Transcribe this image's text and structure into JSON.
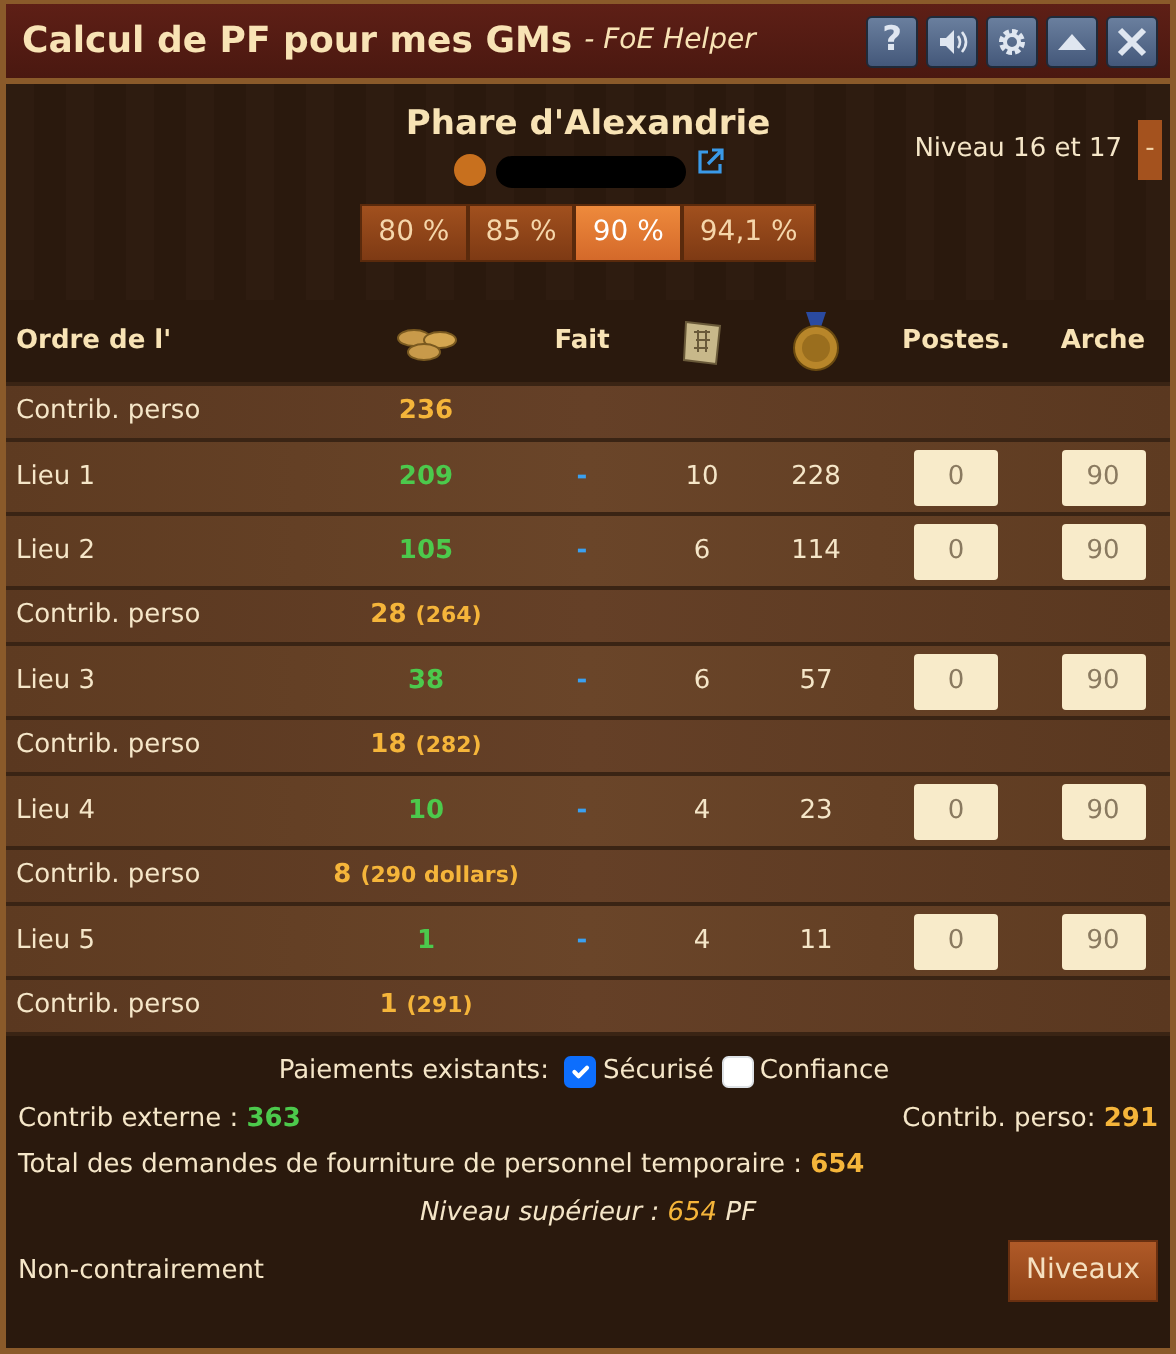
{
  "window": {
    "title": "Calcul de PF pour mes GMs",
    "subtitle": "- FoE Helper",
    "help": "?"
  },
  "building": {
    "name": "Phare d'Alexandrie",
    "level_label": "Niveau 16 et 17",
    "collapse": "-"
  },
  "percentages": [
    {
      "label": "80 %",
      "selected": false
    },
    {
      "label": "85 %",
      "selected": false
    },
    {
      "label": "90 %",
      "selected": true
    },
    {
      "label": "94,1 %",
      "selected": false
    }
  ],
  "columns": {
    "order": "Ordre de l'",
    "done": "Fait",
    "posts": "Postes.",
    "arch": "Arche"
  },
  "rows": [
    {
      "kind": "own",
      "label": "Contrib. perso",
      "amount": "236"
    },
    {
      "kind": "place",
      "label": "Lieu 1",
      "value": "209",
      "done": "-",
      "blueprints": "10",
      "medals": "228",
      "posts": "0",
      "arch": "90"
    },
    {
      "kind": "place",
      "label": "Lieu 2",
      "value": "105",
      "done": "-",
      "blueprints": "6",
      "medals": "114",
      "posts": "0",
      "arch": "90"
    },
    {
      "kind": "own",
      "label": "Contrib. perso",
      "amount": "28",
      "total": "(264)"
    },
    {
      "kind": "place",
      "label": "Lieu 3",
      "value": "38",
      "done": "-",
      "blueprints": "6",
      "medals": "57",
      "posts": "0",
      "arch": "90"
    },
    {
      "kind": "own",
      "label": "Contrib. perso",
      "amount": "18",
      "total": "(282)"
    },
    {
      "kind": "place",
      "label": "Lieu 4",
      "value": "10",
      "done": "-",
      "blueprints": "4",
      "medals": "23",
      "posts": "0",
      "arch": "90"
    },
    {
      "kind": "own",
      "label": "Contrib. perso",
      "amount": "8",
      "total": "(290 dollars)"
    },
    {
      "kind": "place",
      "label": "Lieu 5",
      "value": "1",
      "done": "-",
      "blueprints": "4",
      "medals": "11",
      "posts": "0",
      "arch": "90"
    },
    {
      "kind": "own",
      "label": "Contrib. perso",
      "amount": "1",
      "total": "(291)"
    }
  ],
  "footer": {
    "payments_label": "Paiements existants:",
    "options": [
      {
        "label": "Sécurisé",
        "checked": true
      },
      {
        "label": "Confiance",
        "checked": false
      }
    ],
    "external": {
      "label": "Contrib externe :",
      "value": "363"
    },
    "own": {
      "label": "Contrib. perso:",
      "value": "291"
    },
    "total": {
      "label": "Total des demandes de fourniture de personnel temporaire :",
      "value": "654"
    },
    "next": {
      "label": "Niveau supérieur :",
      "value": "654",
      "unit": "PF"
    },
    "status": "Non-contrairement",
    "levels_button": "Niveaux"
  }
}
